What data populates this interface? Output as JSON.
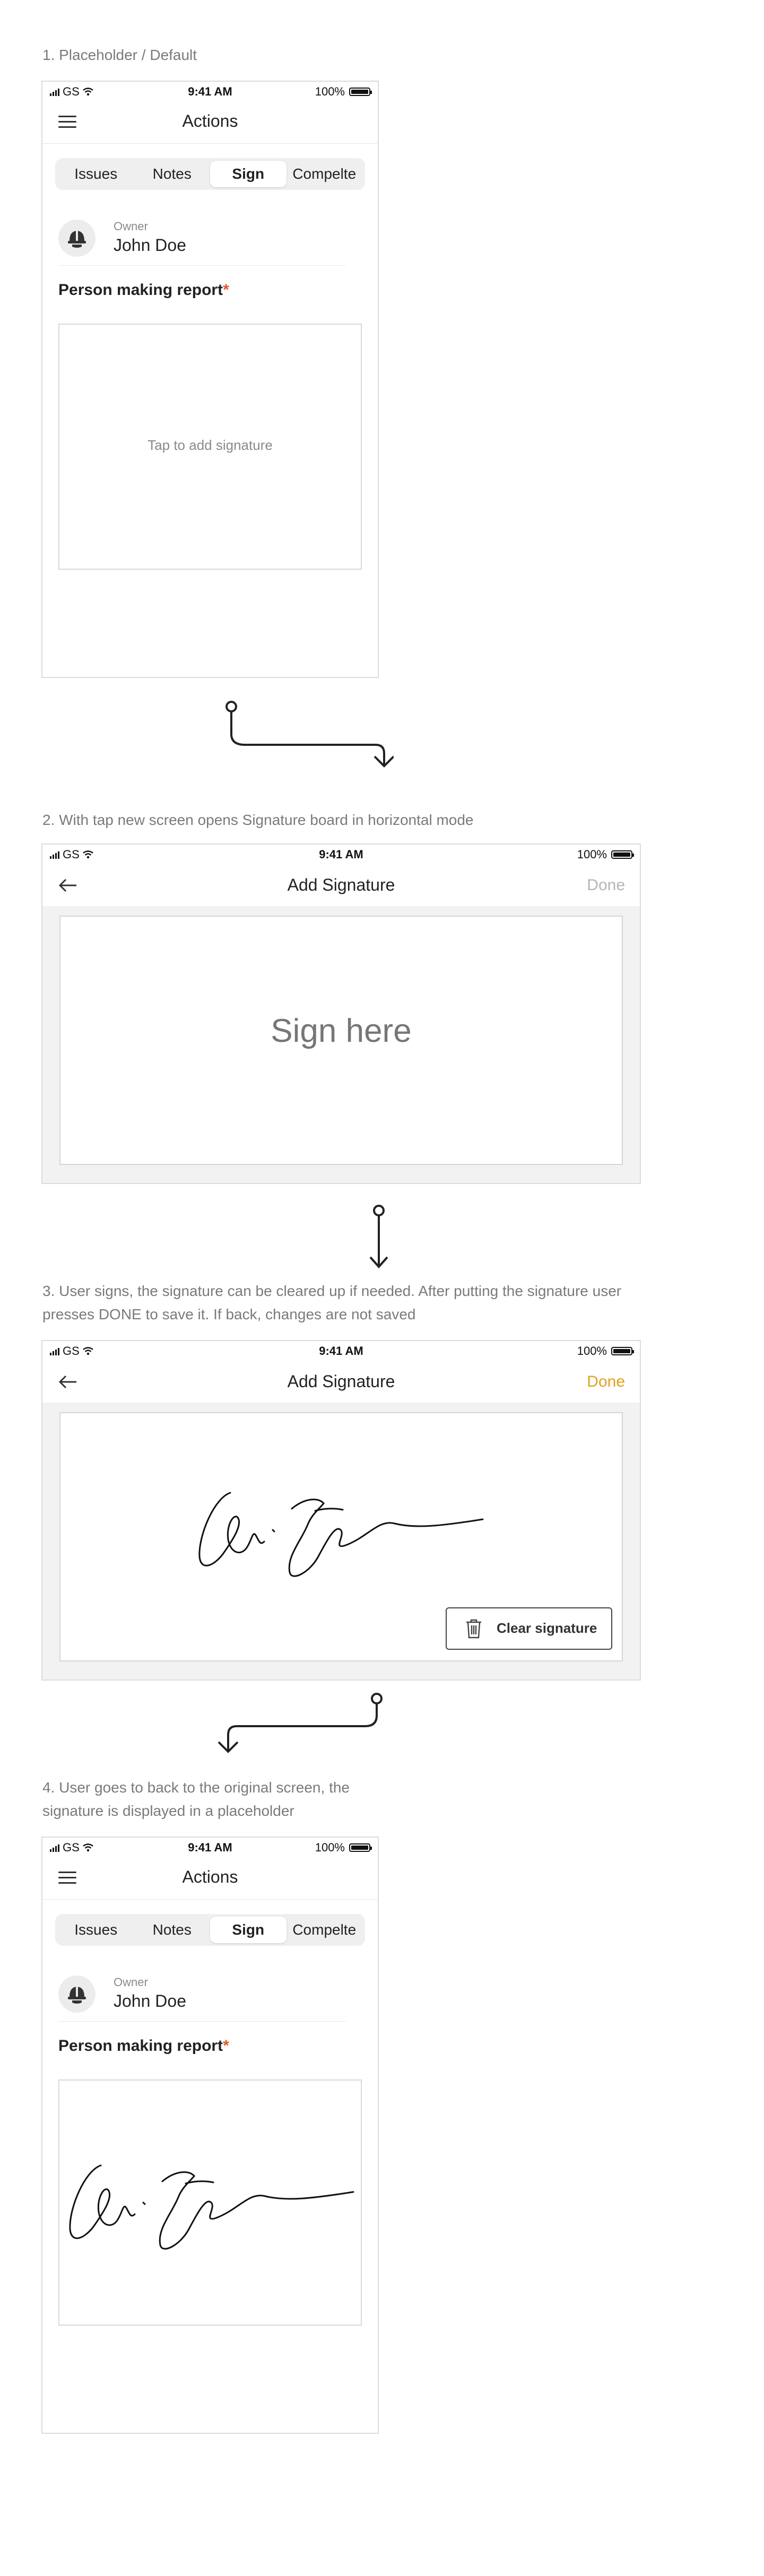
{
  "steps": [
    {
      "caption": "1. Placeholder / Default"
    },
    {
      "caption": "2. With tap new screen opens Signature board in horizontal mode"
    },
    {
      "caption_line1": "3. User signs, the signature can be cleared up if needed. After putting the signature user",
      "caption_line2": "presses DONE to save it. If back, changes are not saved"
    },
    {
      "caption_line1": "4. User goes to back to the original screen, the",
      "caption_line2": "signature is displayed in a placeholder"
    }
  ],
  "statusbar": {
    "carrier": "GS",
    "time": "9:41 AM",
    "battery": "100%"
  },
  "actions_screen": {
    "title": "Actions",
    "tabs": [
      {
        "label": "Issues"
      },
      {
        "label": "Notes"
      },
      {
        "label": "Sign",
        "active": true
      },
      {
        "label": "Compelte"
      }
    ],
    "owner_label": "Owner",
    "owner_name": "John Doe",
    "field_label": "Person making report",
    "required_mark": "*",
    "placeholder_hint": "Tap to add signature"
  },
  "signature_screen": {
    "title": "Add Signature",
    "done_label": "Done",
    "sign_here": "Sign here",
    "clear_label": "Clear signature"
  },
  "colors": {
    "accent": "#e0a21c",
    "disabled": "#b5b5b5",
    "required": "#e05a2b"
  },
  "icons": [
    "signal-icon",
    "wifi-icon",
    "battery-icon",
    "hamburger-icon",
    "helmet-icon",
    "back-arrow-icon",
    "trash-icon",
    "flow-arrow-icon"
  ]
}
